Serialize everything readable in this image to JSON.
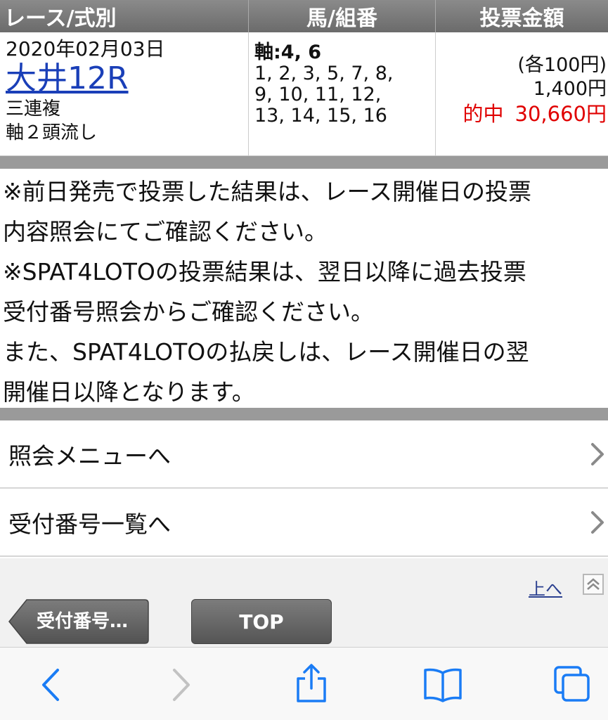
{
  "table": {
    "headers": {
      "race": "レース/式別",
      "horse": "馬/組番",
      "amount": "投票金額"
    },
    "row": {
      "date": "2020年02月03日",
      "race_name": "大井12R",
      "bet_type": "三連複",
      "bet_method": "軸２頭流し",
      "axis": "軸:4, 6",
      "combos": [
        "1, 2, 3, 5, 7, 8,",
        "9, 10, 11, 12,",
        "13, 14, 15, 16"
      ],
      "unit": "(各100円)",
      "total": "1,400円",
      "hit_label": "的中",
      "hit_amount": "30,660円"
    }
  },
  "notes": [
    "※前日発売で投票した結果は、レース開催日の投票",
    "内容照会にてご確認ください。",
    "※SPAT4LOTOの投票結果は、翌日以降に過去投票",
    "受付番号照会からご確認ください。",
    "また、SPAT4LOTOの払戻しは、レース開催日の翌",
    "開催日以降となります。"
  ],
  "menu": [
    {
      "label": "照会メニューへ"
    },
    {
      "label": "受付番号一覧へ"
    }
  ],
  "nav": {
    "to_top": "上へ",
    "back_button": "受付番号…",
    "top_button": "TOP"
  },
  "colors": {
    "link": "#1a3fb8",
    "hit": "#e00000",
    "header_bg": "#777777",
    "ios_blue": "#1a7cf5"
  },
  "icons": {
    "menu_chevron": "chevron-right-icon",
    "to_top": "double-chevron-up-icon",
    "toolbar": [
      "back-arrow-icon",
      "forward-arrow-icon",
      "share-icon",
      "bookmarks-icon",
      "tabs-icon"
    ]
  }
}
